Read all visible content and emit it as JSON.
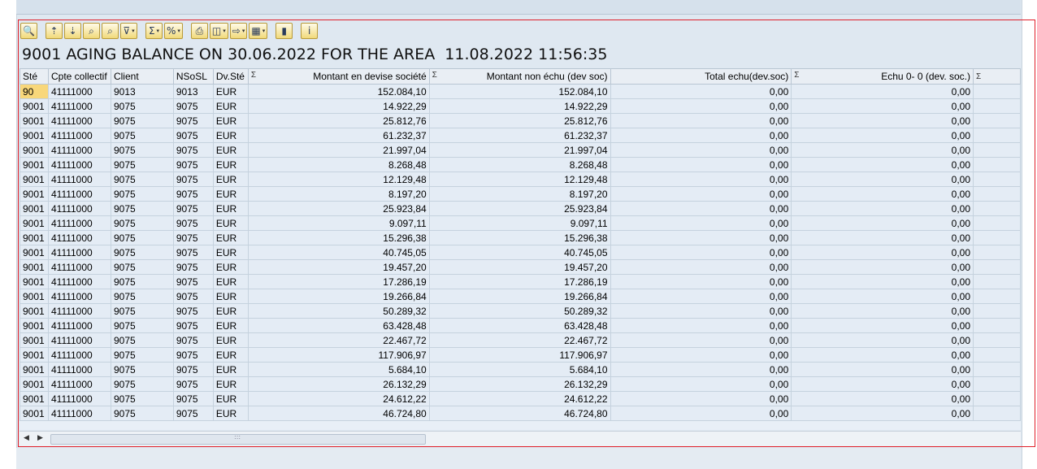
{
  "report": {
    "title": "9001 AGING BALANCE ON 30.06.2022 FOR THE AREA  11.08.2022 11:56:35"
  },
  "toolbar": {
    "buttons": [
      {
        "name": "details-button",
        "icon": "magnifier-icon",
        "glyph": "🔍",
        "dropdown": false
      },
      {
        "name": "sort-ascending-button",
        "icon": "sort-asc-icon",
        "glyph": "⇡",
        "dropdown": false
      },
      {
        "name": "sort-descending-button",
        "icon": "sort-desc-icon",
        "glyph": "⇣",
        "dropdown": false
      },
      {
        "name": "find-button",
        "icon": "binoculars-icon",
        "glyph": "⌕",
        "dropdown": false
      },
      {
        "name": "find-next-button",
        "icon": "binoculars-next-icon",
        "glyph": "⌕",
        "dropdown": false
      },
      {
        "name": "filter-button",
        "icon": "filter-icon",
        "glyph": "⊽",
        "dropdown": true
      },
      {
        "name": "total-button",
        "icon": "sigma-icon",
        "glyph": "Σ",
        "dropdown": true
      },
      {
        "name": "subtotal-button",
        "icon": "subtotal-icon",
        "glyph": "%",
        "dropdown": true
      },
      {
        "name": "print-button",
        "icon": "printer-icon",
        "glyph": "⎙",
        "dropdown": false
      },
      {
        "name": "views-button",
        "icon": "views-icon",
        "glyph": "◫",
        "dropdown": true
      },
      {
        "name": "export-button",
        "icon": "export-icon",
        "glyph": "⇨",
        "dropdown": true
      },
      {
        "name": "layout-button",
        "icon": "layout-grid-icon",
        "glyph": "▦",
        "dropdown": true
      },
      {
        "name": "graphic-button",
        "icon": "bar-chart-icon",
        "glyph": "▮",
        "dropdown": false
      },
      {
        "name": "info-button",
        "icon": "info-icon",
        "glyph": "i",
        "dropdown": false
      }
    ]
  },
  "grid": {
    "sigma": "Σ",
    "columns": [
      {
        "label": "Sté",
        "sigma": false
      },
      {
        "label": "Cpte collectif",
        "sigma": false
      },
      {
        "label": "Client",
        "sigma": false
      },
      {
        "label": "NSoSL",
        "sigma": false
      },
      {
        "label": "Dv.Sté",
        "sigma": true
      },
      {
        "label": "Montant en devise société",
        "sigma": true
      },
      {
        "label": "Montant non échu (dev soc)",
        "sigma": false
      },
      {
        "label": "Total echu(dev.soc)",
        "sigma": true
      },
      {
        "label": "Echu  0- 0 (dev. soc.)",
        "sigma": true
      }
    ],
    "rows": [
      [
        "90",
        "41111000",
        "9013",
        "9013",
        "EUR",
        "152.084,10",
        "152.084,10",
        "0,00",
        "0,00"
      ],
      [
        "9001",
        "41111000",
        "9075",
        "9075",
        "EUR",
        "14.922,29",
        "14.922,29",
        "0,00",
        "0,00"
      ],
      [
        "9001",
        "41111000",
        "9075",
        "9075",
        "EUR",
        "25.812,76",
        "25.812,76",
        "0,00",
        "0,00"
      ],
      [
        "9001",
        "41111000",
        "9075",
        "9075",
        "EUR",
        "61.232,37",
        "61.232,37",
        "0,00",
        "0,00"
      ],
      [
        "9001",
        "41111000",
        "9075",
        "9075",
        "EUR",
        "21.997,04",
        "21.997,04",
        "0,00",
        "0,00"
      ],
      [
        "9001",
        "41111000",
        "9075",
        "9075",
        "EUR",
        "8.268,48",
        "8.268,48",
        "0,00",
        "0,00"
      ],
      [
        "9001",
        "41111000",
        "9075",
        "9075",
        "EUR",
        "12.129,48",
        "12.129,48",
        "0,00",
        "0,00"
      ],
      [
        "9001",
        "41111000",
        "9075",
        "9075",
        "EUR",
        "8.197,20",
        "8.197,20",
        "0,00",
        "0,00"
      ],
      [
        "9001",
        "41111000",
        "9075",
        "9075",
        "EUR",
        "25.923,84",
        "25.923,84",
        "0,00",
        "0,00"
      ],
      [
        "9001",
        "41111000",
        "9075",
        "9075",
        "EUR",
        "9.097,11",
        "9.097,11",
        "0,00",
        "0,00"
      ],
      [
        "9001",
        "41111000",
        "9075",
        "9075",
        "EUR",
        "15.296,38",
        "15.296,38",
        "0,00",
        "0,00"
      ],
      [
        "9001",
        "41111000",
        "9075",
        "9075",
        "EUR",
        "40.745,05",
        "40.745,05",
        "0,00",
        "0,00"
      ],
      [
        "9001",
        "41111000",
        "9075",
        "9075",
        "EUR",
        "19.457,20",
        "19.457,20",
        "0,00",
        "0,00"
      ],
      [
        "9001",
        "41111000",
        "9075",
        "9075",
        "EUR",
        "17.286,19",
        "17.286,19",
        "0,00",
        "0,00"
      ],
      [
        "9001",
        "41111000",
        "9075",
        "9075",
        "EUR",
        "19.266,84",
        "19.266,84",
        "0,00",
        "0,00"
      ],
      [
        "9001",
        "41111000",
        "9075",
        "9075",
        "EUR",
        "50.289,32",
        "50.289,32",
        "0,00",
        "0,00"
      ],
      [
        "9001",
        "41111000",
        "9075",
        "9075",
        "EUR",
        "63.428,48",
        "63.428,48",
        "0,00",
        "0,00"
      ],
      [
        "9001",
        "41111000",
        "9075",
        "9075",
        "EUR",
        "22.467,72",
        "22.467,72",
        "0,00",
        "0,00"
      ],
      [
        "9001",
        "41111000",
        "9075",
        "9075",
        "EUR",
        "117.906,97",
        "117.906,97",
        "0,00",
        "0,00"
      ],
      [
        "9001",
        "41111000",
        "9075",
        "9075",
        "EUR",
        "5.684,10",
        "5.684,10",
        "0,00",
        "0,00"
      ],
      [
        "9001",
        "41111000",
        "9075",
        "9075",
        "EUR",
        "26.132,29",
        "26.132,29",
        "0,00",
        "0,00"
      ],
      [
        "9001",
        "41111000",
        "9075",
        "9075",
        "EUR",
        "24.612,22",
        "24.612,22",
        "0,00",
        "0,00"
      ],
      [
        "9001",
        "41111000",
        "9075",
        "9075",
        "EUR",
        "46.724,80",
        "46.724,80",
        "0,00",
        "0,00"
      ]
    ]
  },
  "scrollbar": {
    "left_glyph": "◀",
    "right_glyph": "▶",
    "grip_glyph": ":::"
  },
  "colors": {
    "focus_frame": "#e0202a",
    "selected_cell": "#f8d77a",
    "toolbar_button": "#f1d97a"
  }
}
